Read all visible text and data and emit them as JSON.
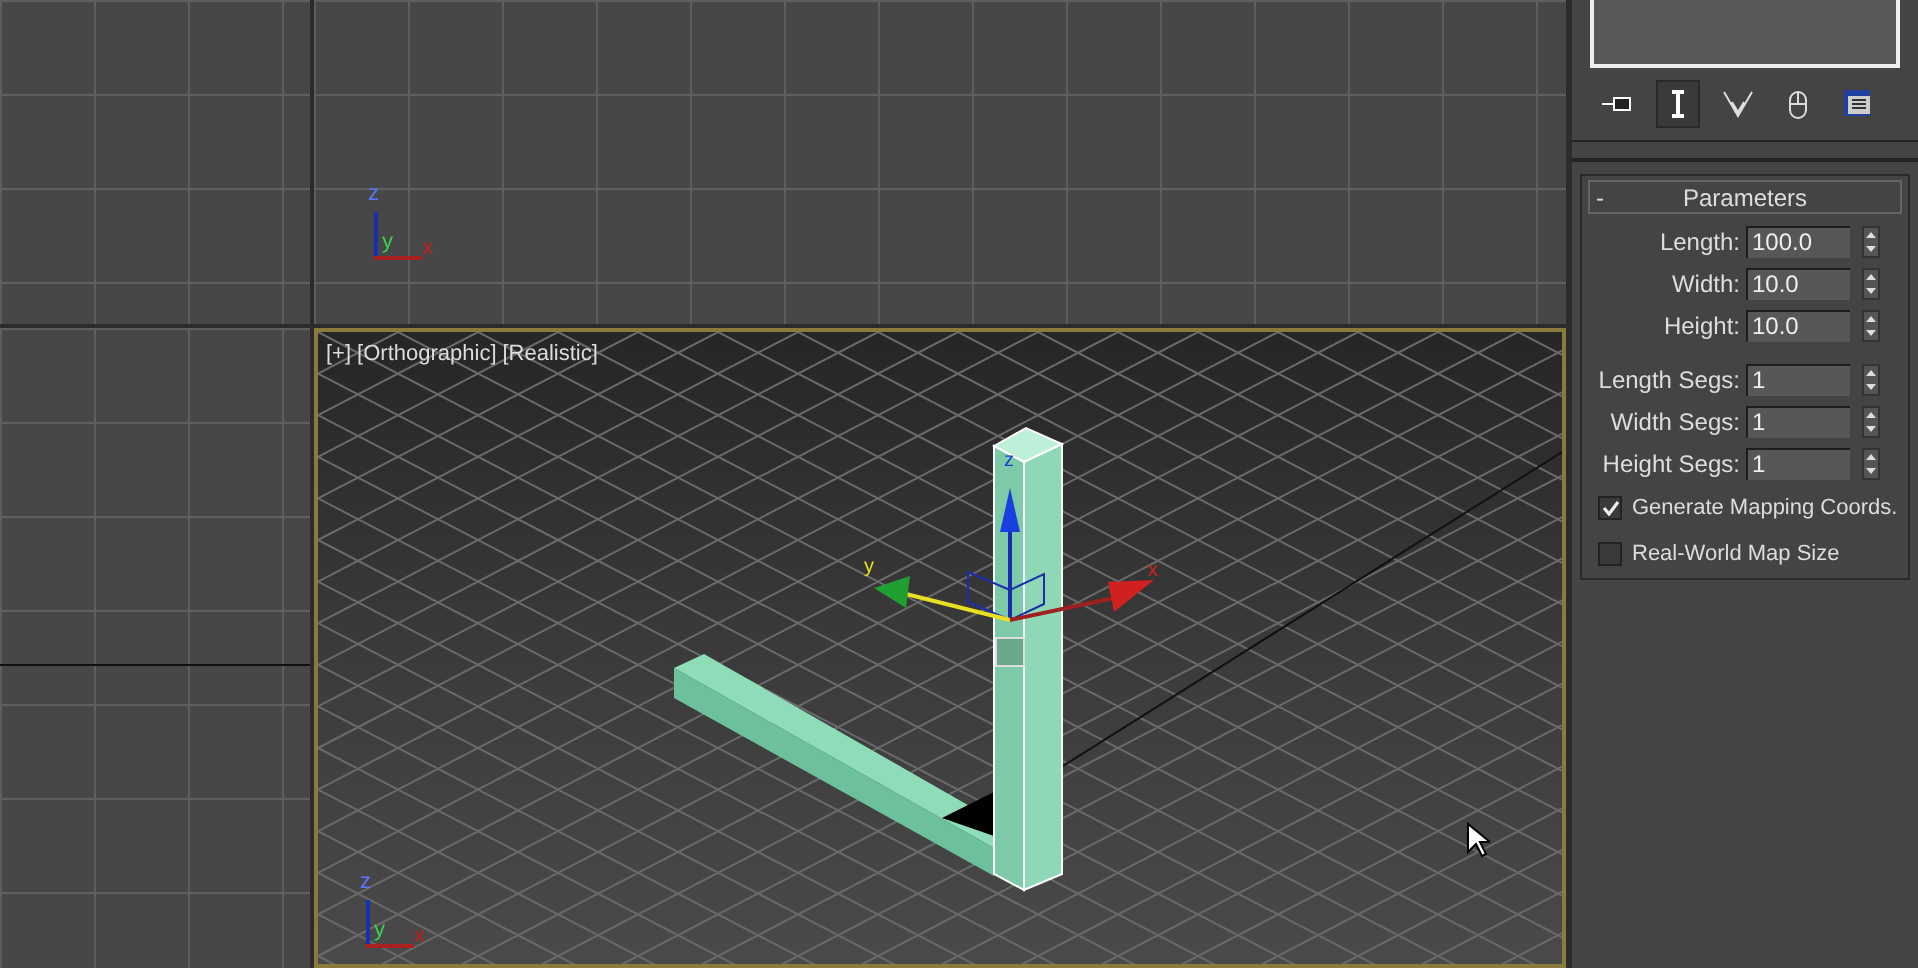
{
  "viewports": {
    "top_tripod": {
      "z": "z",
      "y": "y",
      "x": "x"
    },
    "perspective": {
      "labels": [
        "[+]",
        "[Orthographic]",
        "[Realistic]"
      ],
      "active": true,
      "gizmo": {
        "z": "z",
        "y": "y",
        "x": "x"
      },
      "tripod": {
        "z": "z",
        "y": "y",
        "x": "x"
      }
    }
  },
  "command_panel": {
    "toolbar": [
      {
        "kind": "pin",
        "selected": false
      },
      {
        "kind": "stack",
        "selected": true
      },
      {
        "kind": "funnel",
        "selected": false
      },
      {
        "kind": "mouse",
        "selected": false
      },
      {
        "kind": "config",
        "selected": false
      }
    ],
    "rollout": {
      "collapse": "-",
      "title": "Parameters",
      "fields": [
        {
          "label": "Length:",
          "value": "100.0"
        },
        {
          "label": "Width:",
          "value": "10.0"
        },
        {
          "label": "Height:",
          "value": "10.0"
        }
      ],
      "seg_fields": [
        {
          "label": "Length Segs:",
          "value": "1"
        },
        {
          "label": "Width Segs:",
          "value": "1"
        },
        {
          "label": "Height Segs:",
          "value": "1"
        }
      ],
      "checkboxes": [
        {
          "label": "Generate Mapping Coords.",
          "checked": true
        },
        {
          "label": "Real-World Map Size",
          "checked": false
        }
      ]
    }
  }
}
